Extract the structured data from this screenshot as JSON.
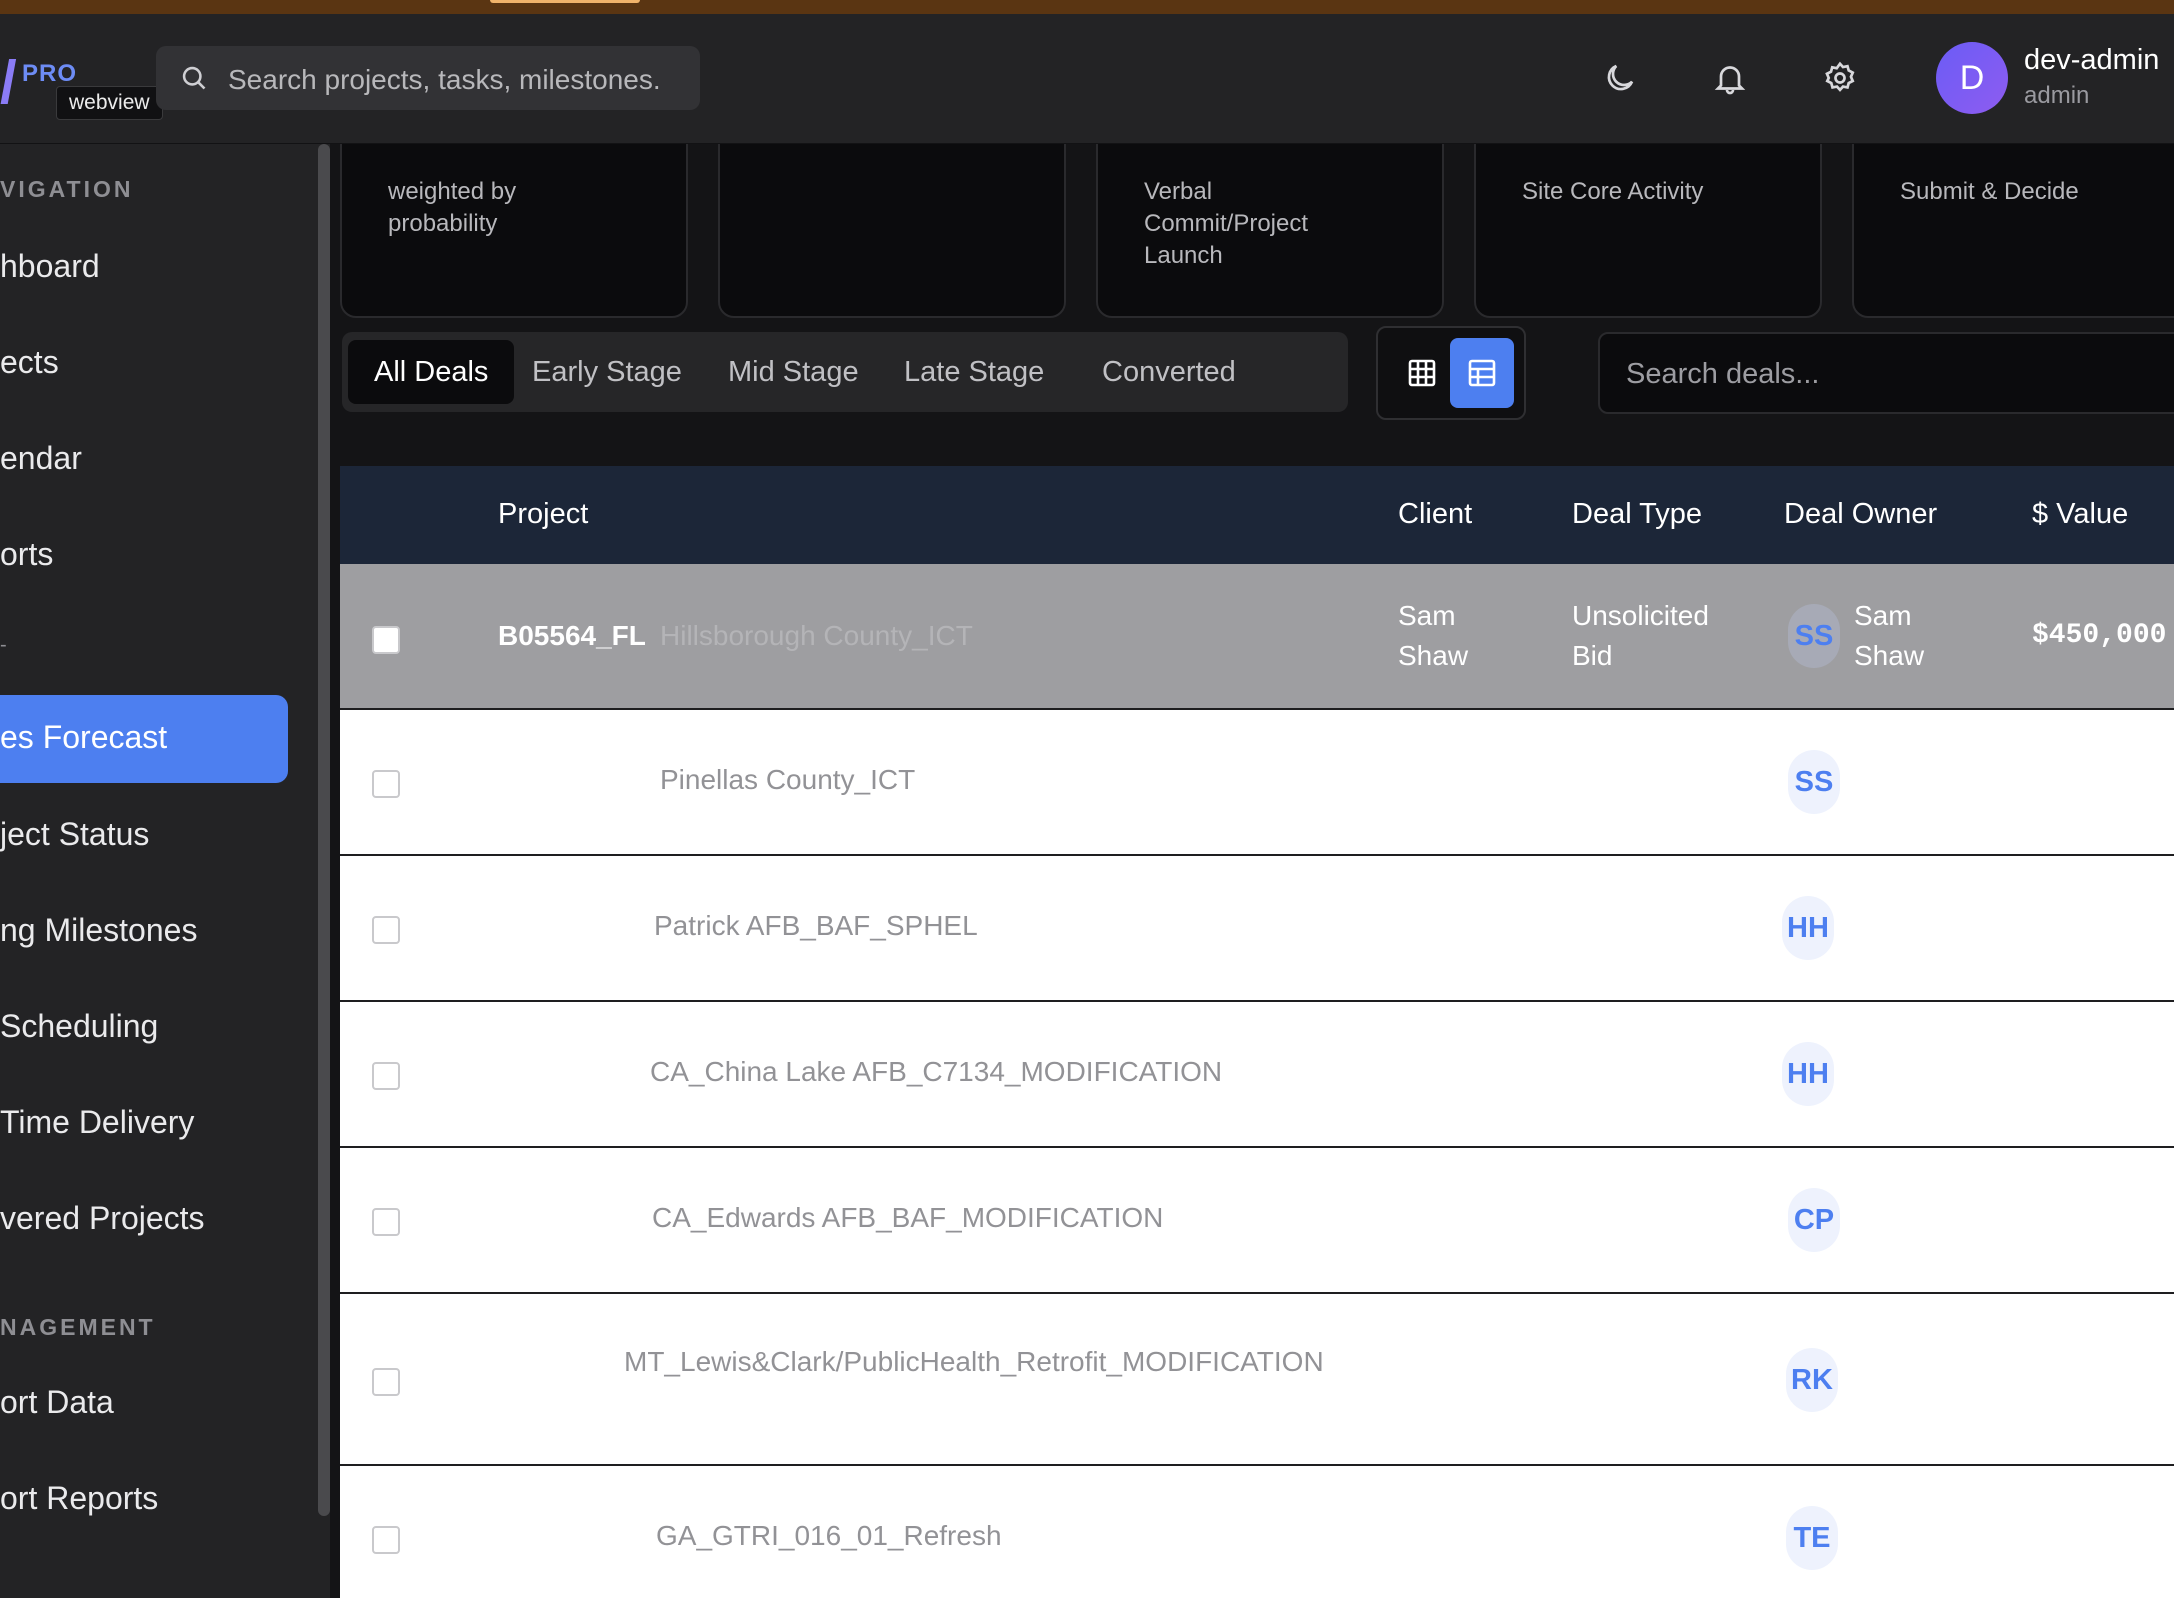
{
  "header": {
    "logo_badge": "PRO",
    "webview_tag": "webview",
    "search_placeholder": "Search projects, tasks, milestones.",
    "user": {
      "initial": "D",
      "name": "dev-admin",
      "role": "admin"
    }
  },
  "sidebar": {
    "section_navigation": "VIGATION",
    "nav_items": [
      "hboard",
      "ects",
      "endar",
      "orts"
    ],
    "misc_mark": "-",
    "active_item": "es Forecast",
    "sub_items": [
      "ject Status",
      "ng Milestones",
      " Scheduling",
      "Time Delivery",
      "vered Projects"
    ],
    "section_management": "NAGEMENT",
    "mgmt_items": [
      "ort Data",
      "ort Reports"
    ]
  },
  "kpis": [
    {
      "text": "weighted by\nprobability"
    },
    {
      "text": ""
    },
    {
      "text": "Verbal\nCommit/Project\nLaunch"
    },
    {
      "text": "Site Core Activity"
    },
    {
      "text": "Submit & Decide"
    }
  ],
  "tabs": [
    "All Deals",
    "Early Stage",
    "Mid Stage",
    "Late Stage",
    "Converted"
  ],
  "active_tab": "All Deals",
  "deal_search_placeholder": "Search deals...",
  "table": {
    "headers": [
      "Project",
      "Client",
      "Deal Type",
      "Deal Owner",
      "$ Value"
    ],
    "selected_row": {
      "code": "B05564_FL",
      "project": "Hillsborough County_ICT",
      "client": "Sam\nShaw",
      "deal_type": "Unsolicited\nBid",
      "owner_initials": "SS",
      "owner_name": "Sam\nShaw",
      "value": "$450,000"
    },
    "rows": [
      {
        "project": "Pinellas County_ICT",
        "owner_initials": "SS"
      },
      {
        "project": "Patrick AFB_BAF_SPHEL",
        "owner_initials": "HH"
      },
      {
        "project": "CA_China Lake AFB_C7134_MODIFICATION",
        "owner_initials": "HH"
      },
      {
        "project": "CA_Edwards AFB_BAF_MODIFICATION",
        "owner_initials": "CP"
      },
      {
        "project": "MT_Lewis&Clark/PublicHealth_Retrofit_MODIFICATION",
        "owner_initials": "RK"
      },
      {
        "project": "GA_GTRI_016_01_Refresh",
        "owner_initials": "TE"
      }
    ]
  },
  "colors": {
    "accent": "#4d7ff0",
    "header_bg": "#232325",
    "table_head": "#1c2638"
  }
}
